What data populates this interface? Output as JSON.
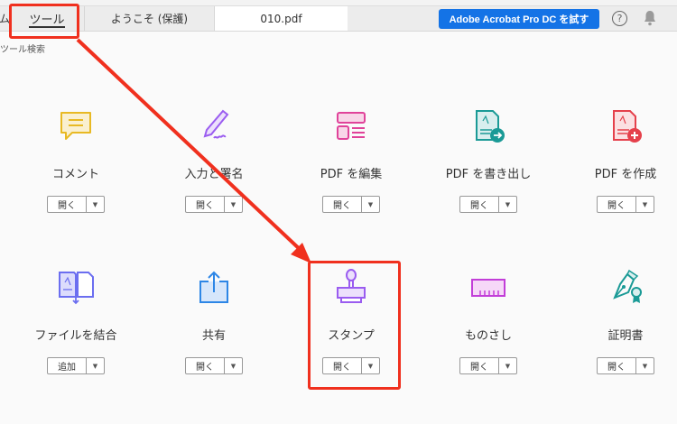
{
  "tabs": {
    "cut_label": "ム",
    "tools": "ツール",
    "welcome": "ようこそ (保護)",
    "file": "010.pdf"
  },
  "trial_button": "Adobe Acrobat Pro DC を試す",
  "help_icon": "?",
  "search_label": "ツール検索",
  "tools": [
    {
      "label": "コメント",
      "button": "開く",
      "icon": "comment-icon",
      "color": "#e8b923"
    },
    {
      "label": "入力と署名",
      "button": "開く",
      "icon": "fill-sign-icon",
      "color": "#9a5cf0"
    },
    {
      "label": "PDF を編集",
      "button": "開く",
      "icon": "edit-pdf-icon",
      "color": "#e0439a"
    },
    {
      "label": "PDF を書き出し",
      "button": "開く",
      "icon": "export-pdf-icon",
      "color": "#1a9a96"
    },
    {
      "label": "PDF を作成",
      "button": "開く",
      "icon": "create-pdf-icon",
      "color": "#e5404b"
    },
    {
      "label": "ファイルを結合",
      "button": "追加",
      "icon": "combine-files-icon",
      "color": "#6b6ef0"
    },
    {
      "label": "共有",
      "button": "開く",
      "icon": "share-icon",
      "color": "#2d86e6"
    },
    {
      "label": "スタンプ",
      "button": "開く",
      "icon": "stamp-icon",
      "color": "#9a5cf0"
    },
    {
      "label": "ものさし",
      "button": "開く",
      "icon": "measure-icon",
      "color": "#c23ed8"
    },
    {
      "label": "証明書",
      "button": "開く",
      "icon": "certificate-icon",
      "color": "#1a9a96"
    }
  ],
  "annotation_color": "#f0301e"
}
